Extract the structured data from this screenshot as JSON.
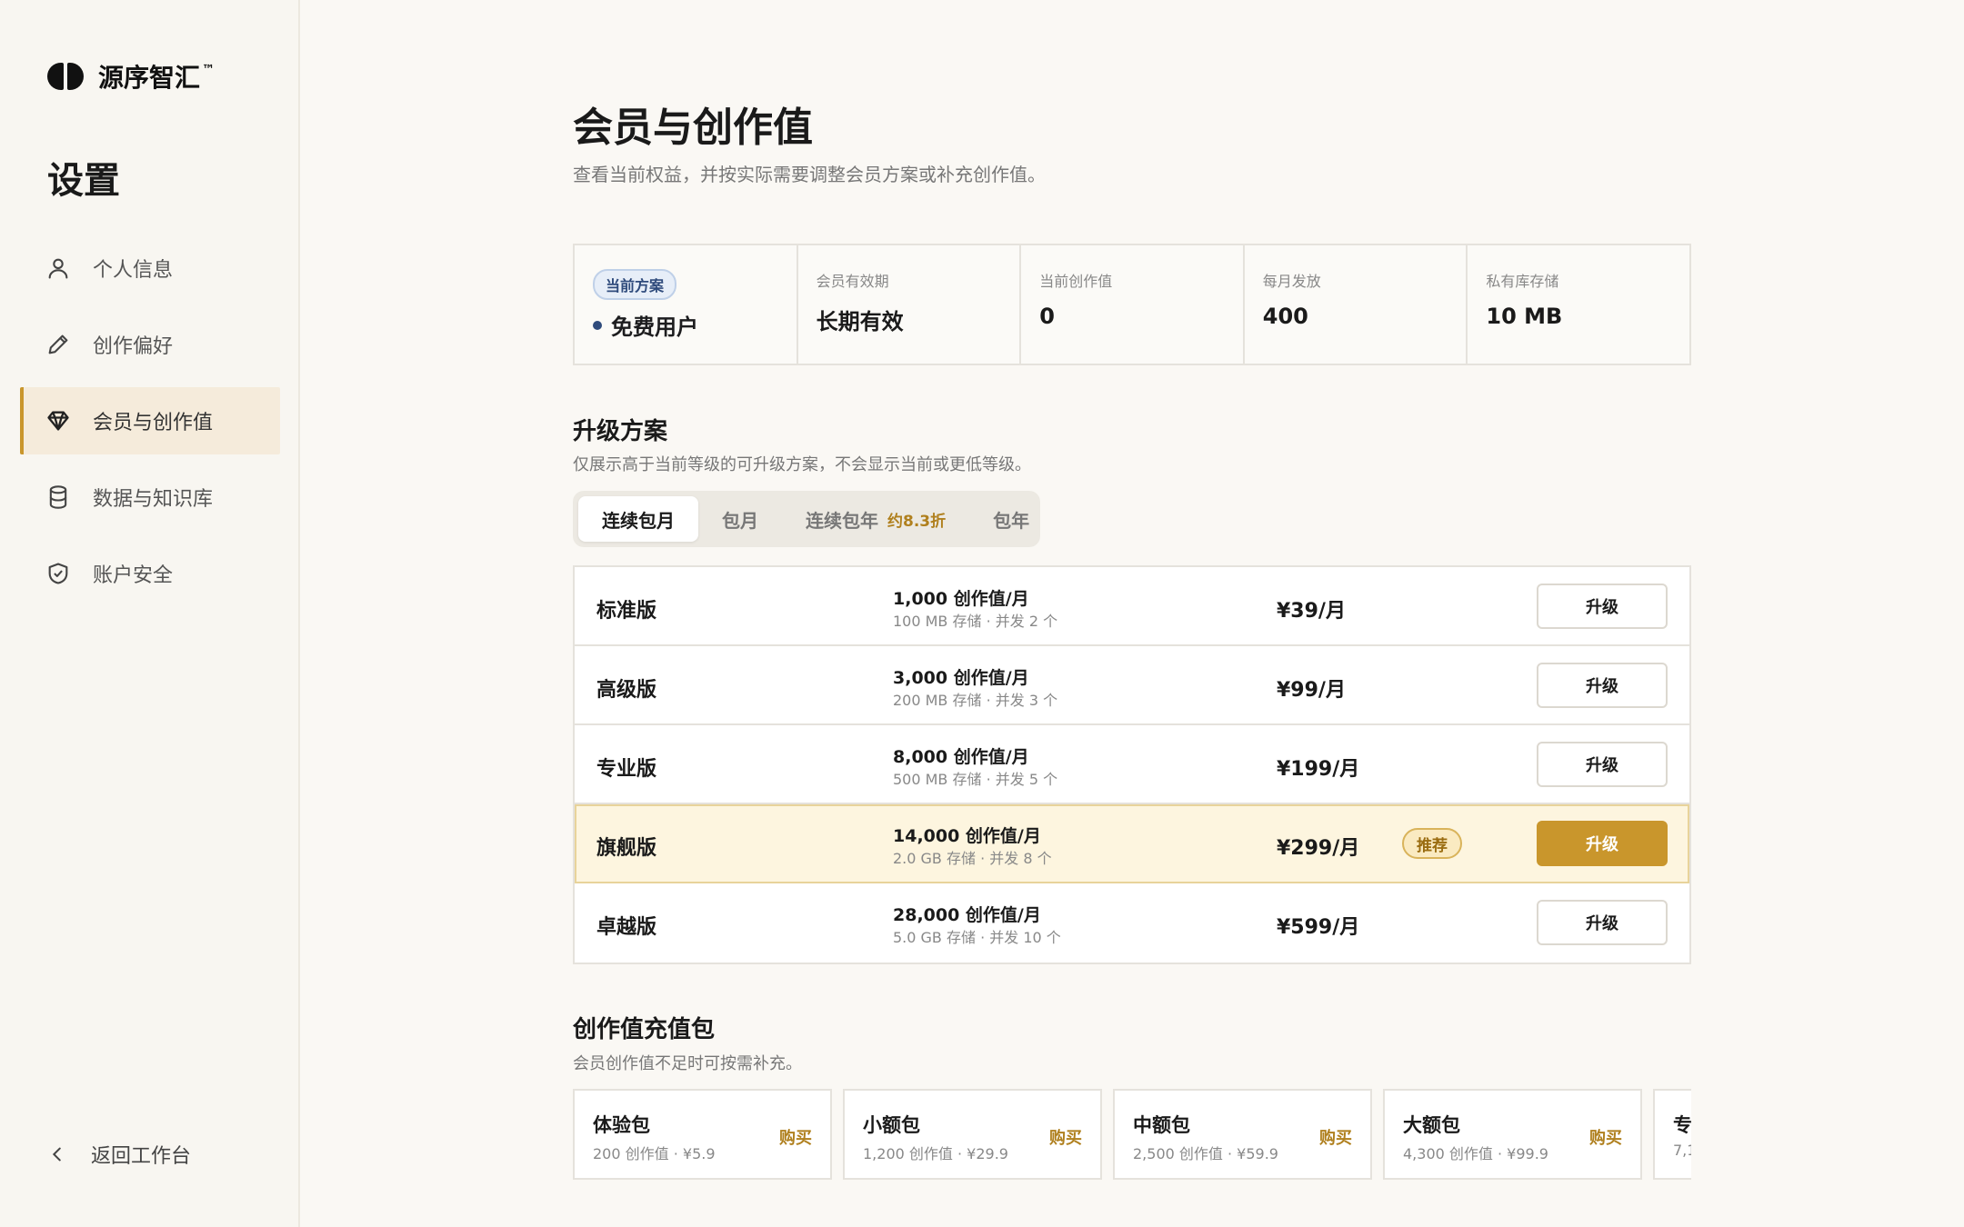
{
  "brand": {
    "name": "源序智汇",
    "tm": "™"
  },
  "sidebar": {
    "title": "设置",
    "items": [
      {
        "label": "个人信息",
        "icon": "user-icon"
      },
      {
        "label": "创作偏好",
        "icon": "pencil-icon"
      },
      {
        "label": "会员与创作值",
        "icon": "diamond-icon",
        "active": true
      },
      {
        "label": "数据与知识库",
        "icon": "database-icon"
      },
      {
        "label": "账户安全",
        "icon": "shield-icon"
      }
    ],
    "back_label": "返回工作台"
  },
  "page": {
    "title": "会员与创作值",
    "subtitle": "查看当前权益，并按实际需要调整会员方案或补充创作值。"
  },
  "summary": {
    "plan_badge": "当前方案",
    "plan_name": "免费用户",
    "cells": [
      {
        "label": "会员有效期",
        "value": "长期有效"
      },
      {
        "label": "当前创作值",
        "value": "0"
      },
      {
        "label": "每月发放",
        "value": "400"
      },
      {
        "label": "私有库存储",
        "value": "10 MB"
      }
    ]
  },
  "upgrade": {
    "title": "升级方案",
    "subtitle": "仅展示高于当前等级的可升级方案，不会显示当前或更低等级。",
    "tabs": [
      {
        "label": "连续包月",
        "active": true
      },
      {
        "label": "包月"
      },
      {
        "label": "连续包年",
        "discount": "约8.3折"
      },
      {
        "label": "包年"
      }
    ],
    "plans": [
      {
        "name": "标准版",
        "credits": "1,000 创作值/月",
        "detail": "100 MB 存储 · 并发 2 个",
        "price": "¥39/月",
        "button": "升级"
      },
      {
        "name": "高级版",
        "credits": "3,000 创作值/月",
        "detail": "200 MB 存储 · 并发 3 个",
        "price": "¥99/月",
        "button": "升级"
      },
      {
        "name": "专业版",
        "credits": "8,000 创作值/月",
        "detail": "500 MB 存储 · 并发 5 个",
        "price": "¥199/月",
        "button": "升级"
      },
      {
        "name": "旗舰版",
        "credits": "14,000 创作值/月",
        "detail": "2.0 GB 存储 · 并发 8 个",
        "price": "¥299/月",
        "badge": "推荐",
        "button": "升级",
        "featured": true
      },
      {
        "name": "卓越版",
        "credits": "28,000 创作值/月",
        "detail": "5.0 GB 存储 · 并发 10 个",
        "price": "¥599/月",
        "button": "升级"
      }
    ]
  },
  "packs": {
    "title": "创作值充值包",
    "subtitle": "会员创作值不足时可按需补充。",
    "items": [
      {
        "name": "体验包",
        "detail": "200 创作值 · ¥5.9",
        "buy": "购买"
      },
      {
        "name": "小额包",
        "detail": "1,200 创作值 · ¥29.9",
        "buy": "购买"
      },
      {
        "name": "中额包",
        "detail": "2,500 创作值 · ¥59.9",
        "buy": "购买"
      },
      {
        "name": "大额包",
        "detail": "4,300 创作值 · ¥99.9",
        "buy": "购买"
      },
      {
        "name": "专",
        "detail": "7,1",
        "buy": ""
      }
    ]
  },
  "colors": {
    "accent": "#c9962c",
    "active_nav_bg": "#f5ebdb",
    "featured_bg": "#fdf5df",
    "plan_badge": "#2f4b7c"
  }
}
